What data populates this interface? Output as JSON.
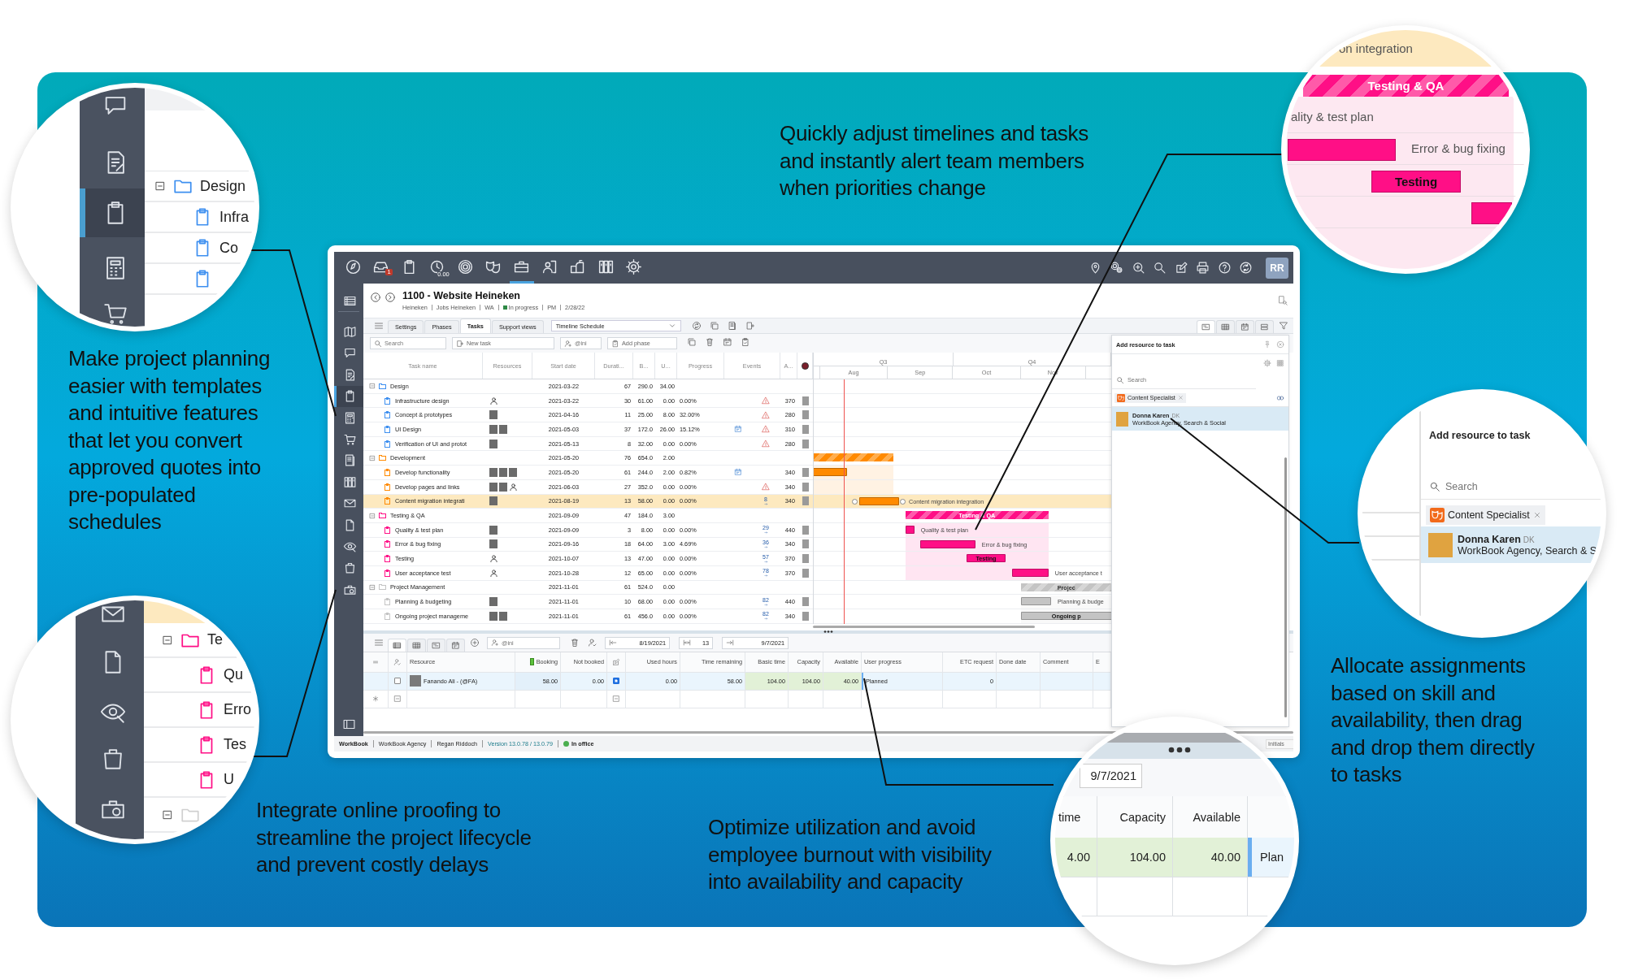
{
  "callouts": [
    {
      "text": "Quickly adjust timelines and tasks\nand instantly alert team members\nwhen priorities change"
    },
    {
      "text": "Make project planning\neasier with templates\nand intuitive features\nthat let you convert\napproved quotes into\npre-populated\nschedules"
    },
    {
      "text": "Allocate assignments\nbased on skill and\navailability, then drag\nand drop them directly\nto tasks"
    },
    {
      "text": "Integrate online proofing to\nstreamline the project lifecycle\nand prevent costly delays"
    },
    {
      "text": "Optimize utilization and avoid\nemployee burnout with visibility\ninto availability and capacity"
    }
  ],
  "app": {
    "topbar": {
      "nav": [
        {
          "selected": false
        },
        {
          "selected": false,
          "badge": "1"
        },
        {
          "selected": false
        },
        {
          "selected": false,
          "badge": "0.00"
        },
        {
          "selected": false
        },
        {
          "selected": false
        },
        {
          "selected": true
        },
        {
          "selected": false
        },
        {
          "selected": false
        },
        {
          "selected": false
        },
        {
          "selected": false
        }
      ],
      "user_initials": "RR"
    },
    "sidebar": {
      "items": [
        {
          "selected": false
        },
        {
          "selected": false
        },
        {
          "selected": false
        },
        {
          "selected": false
        },
        {
          "selected": true
        },
        {
          "selected": false
        },
        {
          "selected": false
        },
        {
          "selected": false
        },
        {
          "selected": false
        },
        {
          "selected": false
        },
        {
          "selected": false
        },
        {
          "selected": false
        },
        {
          "selected": false
        },
        {
          "selected": false
        }
      ]
    },
    "header": {
      "title": "1100 - Website Heineken",
      "meta": [
        {
          "kind": "text",
          "text": "Heineken"
        },
        {
          "kind": "text",
          "text": "Jobs Heineken"
        },
        {
          "kind": "text",
          "text": "WA"
        },
        {
          "kind": "status",
          "text": "In progress"
        },
        {
          "kind": "text",
          "text": "PM"
        },
        {
          "kind": "text",
          "text": "2/28/22"
        }
      ]
    },
    "tabs": [
      {
        "label": "Settings",
        "selected": false
      },
      {
        "label": "Phases",
        "selected": false
      },
      {
        "label": "Tasks",
        "selected": true
      },
      {
        "label": "Support views",
        "selected": false
      }
    ],
    "view_select": {
      "value": "Timeline Schedule"
    },
    "search": {
      "placeholder": "Search"
    },
    "new_task": {
      "label": "New task"
    },
    "assignee_filter": {
      "placeholder": "@ini"
    },
    "add_phase": {
      "label": "Add phase"
    },
    "view_buttons": [
      {
        "selected": true
      },
      {
        "selected": false
      },
      {
        "selected": false
      },
      {
        "selected": false
      }
    ],
    "table": {
      "columns": [
        "Task name",
        "Resources",
        "Start date",
        "Durati...",
        "B...",
        "U...",
        "Progress",
        "Events",
        "A..."
      ],
      "groups": [
        {
          "name": "Design",
          "color": "#3d8ff0",
          "expanded": true,
          "start": "2021-03-22",
          "duration": "67",
          "b": "290.0",
          "u": "34.00",
          "children": [
            {
              "name": "Infrastructure design",
              "resources": [
                {
                  "kind": "person"
                }
              ],
              "start": "2021-03-22",
              "duration": "30",
              "b": "61.00",
              "u": "0.00",
              "progress": "0.00%",
              "calendar": false,
              "warning": true,
              "a": "370",
              "selected": false
            },
            {
              "name": "Concept & prototypes",
              "resources": [
                {
                  "kind": "photo"
                }
              ],
              "start": "2021-04-16",
              "duration": "11",
              "b": "25.00",
              "u": "8.00",
              "progress": "32.00%",
              "calendar": false,
              "warning": true,
              "a": "280",
              "selected": false
            },
            {
              "name": "UI Design",
              "resources": [
                {
                  "kind": "photo"
                },
                {
                  "kind": "photo"
                }
              ],
              "start": "2021-05-03",
              "duration": "37",
              "b": "172.0",
              "u": "26.00",
              "progress": "15.12%",
              "calendar": true,
              "warning": true,
              "a": "310",
              "selected": false
            },
            {
              "name": "Verification of UI and protot",
              "resources": [
                {
                  "kind": "photo"
                }
              ],
              "start": "2021-05-13",
              "duration": "8",
              "b": "32.00",
              "u": "0.00",
              "progress": "0.00%",
              "calendar": false,
              "warning": true,
              "a": "280",
              "selected": false
            }
          ]
        },
        {
          "name": "Development",
          "color": "#ff8a00",
          "expanded": true,
          "start": "2021-05-20",
          "duration": "76",
          "b": "654.0",
          "u": "2.00",
          "children": [
            {
              "name": "Develop functionality",
              "resources": [
                {
                  "kind": "photo"
                },
                {
                  "kind": "photo"
                },
                {
                  "kind": "photo"
                }
              ],
              "start": "2021-05-20",
              "duration": "61",
              "b": "244.0",
              "u": "2.00",
              "progress": "0.82%",
              "calendar": true,
              "warning": false,
              "a": "340",
              "selected": false
            },
            {
              "name": "Develop pages and links",
              "resources": [
                {
                  "kind": "photo"
                },
                {
                  "kind": "photo"
                },
                {
                  "kind": "person"
                }
              ],
              "start": "2021-06-03",
              "duration": "27",
              "b": "352.0",
              "u": "0.00",
              "progress": "0.00%",
              "calendar": false,
              "warning": true,
              "a": "340",
              "selected": false
            },
            {
              "name": "Content migration integrati",
              "resources": [
                {
                  "kind": "photo"
                }
              ],
              "start": "2021-08-19",
              "duration": "13",
              "b": "58.00",
              "u": "0.00",
              "progress": "0.00%",
              "calendar": false,
              "warning": false,
              "link": "8",
              "a": "340",
              "selected": true,
              "bar_label": "Content migration integration",
              "label_inside": false
            }
          ]
        },
        {
          "name": "Testing & QA",
          "color": "#ff0f86",
          "expanded": true,
          "start": "2021-09-09",
          "duration": "47",
          "b": "184.0",
          "u": "3.00",
          "bar_label": "Testing & QA",
          "children": [
            {
              "name": "Quality & test plan",
              "resources": [
                {
                  "kind": "photo"
                }
              ],
              "start": "2021-09-09",
              "duration": "3",
              "b": "8.00",
              "u": "0.00",
              "progress": "0.00%",
              "calendar": false,
              "warning": false,
              "link": "29",
              "a": "440",
              "selected": false,
              "bar_label": "Quality & test plan",
              "label_inside": false
            },
            {
              "name": "Error & bug fixing",
              "resources": [
                {
                  "kind": "photo"
                }
              ],
              "start": "2021-09-16",
              "duration": "18",
              "b": "64.00",
              "u": "3.00",
              "progress": "4.69%",
              "calendar": false,
              "warning": false,
              "link": "36",
              "a": "340",
              "selected": false,
              "bar_label": "Error & bug fixing",
              "label_inside": false
            },
            {
              "name": "Testing",
              "resources": [
                {
                  "kind": "person"
                }
              ],
              "start": "2021-10-07",
              "duration": "13",
              "b": "47.00",
              "u": "0.00",
              "progress": "0.00%",
              "calendar": false,
              "warning": false,
              "link": "57",
              "a": "370",
              "selected": false,
              "bar_label": "Testing",
              "label_inside": true
            },
            {
              "name": "User acceptance test",
              "resources": [
                {
                  "kind": "person"
                }
              ],
              "start": "2021-10-28",
              "duration": "12",
              "b": "65.00",
              "u": "0.00",
              "progress": "0.00%",
              "calendar": false,
              "warning": false,
              "link": "78",
              "a": "370",
              "selected": false,
              "bar_label": "User acceptance t",
              "label_inside": false
            }
          ]
        },
        {
          "name": "Project Management",
          "color": "#c4c4c4",
          "expanded": true,
          "start": "2021-11-01",
          "duration": "61",
          "b": "524.0",
          "u": "0.00",
          "bar_label": "Projec",
          "children": [
            {
              "name": "Planning & budgeting",
              "resources": [
                {
                  "kind": "photo"
                }
              ],
              "start": "2021-11-01",
              "duration": "10",
              "b": "68.00",
              "u": "0.00",
              "progress": "0.00%",
              "calendar": false,
              "warning": false,
              "link": "82",
              "a": "440",
              "selected": false,
              "bar_label": "Planning & budge",
              "label_inside": false
            },
            {
              "name": "Ongoing project manageme",
              "resources": [
                {
                  "kind": "photo"
                },
                {
                  "kind": "photo"
                }
              ],
              "start": "2021-11-01",
              "duration": "61",
              "b": "456.0",
              "u": "0.00",
              "progress": "0.00%",
              "calendar": false,
              "warning": false,
              "link": "82",
              "a": "340",
              "selected": false,
              "bar_label": "Ongoing p",
              "label_inside": true
            }
          ]
        }
      ]
    },
    "gantt": {
      "quarters": [
        "Q3",
        "Q4"
      ],
      "months": [
        "Aug",
        "Sep",
        "Oct",
        "Nov"
      ]
    },
    "bottom": {
      "views": [
        {
          "selected": true
        },
        {
          "selected": false
        },
        {
          "selected": false
        },
        {
          "selected": false
        }
      ],
      "filter": {
        "placeholder": "@ini"
      },
      "from": "8/19/2021",
      "days": "13",
      "to": "9/7/2021",
      "columns": [
        "Resource",
        "Booking",
        "Not booked",
        "Used hours",
        "Time remaining",
        "Basic time",
        "Capacity",
        "Available",
        "User progress",
        "ETC request",
        "Done date",
        "Comment",
        "E"
      ],
      "rows": [
        {
          "resource": "Fanando Ali - (@FA)",
          "checked": false,
          "booking": "58.00",
          "not_booked": "0.00",
          "confirmed": true,
          "used_hours": "0.00",
          "time_remaining": "58.00",
          "basic_time": "104.00",
          "capacity": "104.00",
          "available": "40.00",
          "user_progress": "Planned",
          "etc_request": "0"
        }
      ]
    },
    "resource_panel": {
      "title": "Add resource to task",
      "search": {
        "placeholder": "Search"
      },
      "tags": [
        {
          "label": "Content Specialist"
        }
      ],
      "people": [
        {
          "name": "Donna Karen",
          "initials": "DK",
          "detail": "WorkBook Agency, Search & Social",
          "selected": true
        }
      ]
    },
    "status_bar": {
      "items": [
        "WorkBook",
        "WorkBook Agency",
        "Regan Riddoch",
        "Version 13.0.78 / 13.0.79"
      ],
      "presence": "In office",
      "initials_placeholder": "Initials"
    }
  },
  "insets": {
    "templates": {
      "sidebar": [
        {
          "selected": false
        },
        {
          "selected": false
        },
        {
          "selected": true
        },
        {
          "selected": false
        },
        {
          "selected": false
        }
      ],
      "rows": [
        {
          "kind": "group",
          "label": "Design",
          "color": "#3d8ff0"
        },
        {
          "kind": "task",
          "label": "Infra",
          "color": "#3d8ff0"
        },
        {
          "kind": "task",
          "label": "Co",
          "color": "#3d8ff0"
        },
        {
          "kind": "task",
          "color": "#3d8ff0"
        }
      ]
    },
    "proofing": {
      "sidebar": [
        {
          "selected": false
        },
        {
          "selected": false
        },
        {
          "selected": false
        },
        {
          "selected": false
        },
        {
          "selected": false
        }
      ],
      "rows": [
        {
          "kind": "group",
          "label": "Te",
          "color": "#ff0f86"
        },
        {
          "kind": "task",
          "label": "Qu",
          "color": "#ff0f86"
        },
        {
          "kind": "task",
          "label": "Erro",
          "color": "#ff0f86"
        },
        {
          "kind": "task",
          "label": "Tes",
          "color": "#ff0f86"
        },
        {
          "kind": "task",
          "label": "U",
          "color": "#ff0f86"
        },
        {
          "kind": "group",
          "color": "#d0d0d0"
        }
      ]
    },
    "timeline": {
      "highlight": "on integration",
      "phase": "Testing & QA",
      "rows": [
        {
          "kind": "text",
          "label": "ality & test plan"
        },
        {
          "kind": "beside",
          "label": "Error & bug fixing"
        },
        {
          "kind": "inside",
          "label": "Testing"
        },
        {
          "kind": "bar"
        }
      ]
    },
    "resources": {
      "title": "Add resource to task",
      "search_placeholder": "Search",
      "tag": "Content Specialist",
      "person": {
        "name": "Donna Karen",
        "initials": "DK",
        "detail": "WorkBook Agency, Search & S",
        "selected": true
      }
    },
    "capacity": {
      "date": "9/7/2021",
      "columns": [
        "time",
        "Capacity",
        "Available"
      ],
      "values": [
        "4.00",
        "104.00",
        "40.00"
      ],
      "progress": "Plan"
    }
  }
}
